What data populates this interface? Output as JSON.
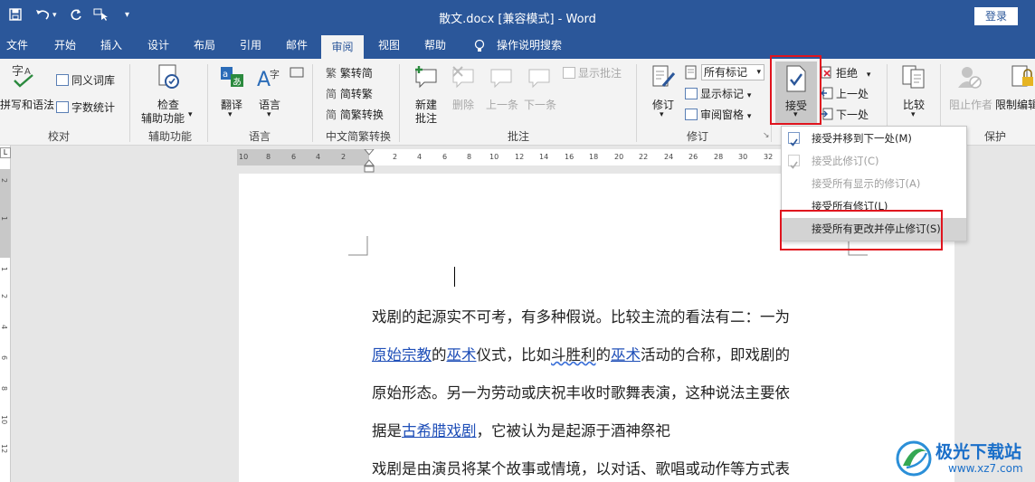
{
  "title_bar": {
    "title": "散文.docx [兼容模式] - Word",
    "login_label": "登录"
  },
  "tabs": [
    "文件",
    "开始",
    "插入",
    "设计",
    "布局",
    "引用",
    "邮件",
    "审阅",
    "视图",
    "帮助",
    "操作说明搜索"
  ],
  "ribbon": {
    "proofing": {
      "spell": "拼写和语法",
      "thesaurus": "同义词库",
      "word_count": "字数统计",
      "group": "校对"
    },
    "accessibility": {
      "check_line1": "检查",
      "check_line2": "辅助功能",
      "group": "辅助功能"
    },
    "language": {
      "translate": "翻译",
      "language": "语言",
      "group": "语言"
    },
    "chinese": {
      "to_simplified": "繁转简",
      "to_traditional": "简转繁",
      "convert": "简繁转换",
      "group": "中文简繁转换"
    },
    "comments": {
      "new_line1": "新建",
      "new_line2": "批注",
      "delete": "删除",
      "prev": "上一条",
      "next": "下一条",
      "show": "显示批注",
      "group": "批注"
    },
    "tracking": {
      "track": "修订",
      "markup_select": "所有标记",
      "show_markup": "显示标记",
      "review_pane": "审阅窗格",
      "group": "修订"
    },
    "changes": {
      "accept": "接受",
      "reject": "拒绝",
      "previous": "上一处",
      "next": "下一处"
    },
    "compare": {
      "compare": "比较"
    },
    "protect": {
      "block_authors": "阻止作者",
      "restrict": "限制编辑",
      "group": "保护"
    }
  },
  "accept_menu": [
    {
      "label": "接受并移到下一处(M)",
      "enabled": true,
      "icon": "accept-check-icon"
    },
    {
      "label": "接受此修订(C)",
      "enabled": false,
      "icon": "accept-check-icon"
    },
    {
      "label": "接受所有显示的修订(A)",
      "enabled": false,
      "icon": ""
    },
    {
      "label": "接受所有修订(L)",
      "enabled": true,
      "icon": ""
    },
    {
      "label": "接受所有更改并停止修订(S)",
      "enabled": true,
      "highlighted": true,
      "icon": ""
    }
  ],
  "ruler": {
    "h_ticks": [
      "10",
      "8",
      "6",
      "4",
      "2",
      "2",
      "4",
      "6",
      "8",
      "10",
      "12",
      "14",
      "16",
      "18",
      "20",
      "22",
      "24",
      "26",
      "28",
      "30",
      "32"
    ],
    "v_ticks": [
      "2",
      "1",
      "1",
      "2",
      "4",
      "6",
      "8",
      "10",
      "12"
    ]
  },
  "document": {
    "line1": "戏剧的起源实不可考，有多种假说。比较主流的看法有二：一为",
    "line2": [
      {
        "text": "原始宗教",
        "link": true
      },
      {
        "text": "的"
      },
      {
        "text": "巫术",
        "link": true
      },
      {
        "text": "仪式，比如"
      },
      {
        "text": "斗胜利",
        "wavy": true
      },
      {
        "text": "的"
      },
      {
        "text": "巫术",
        "link": true
      },
      {
        "text": "活动的合称，即戏剧的"
      }
    ],
    "line3": "原始形态。另一为劳动或庆祝丰收时歌舞表演，这种说法主要依",
    "line4_pre": "据是",
    "line4_link": "古希腊戏剧",
    "line4_post": "，它被认为是起源于酒神祭祀",
    "line5": "戏剧是由演员将某个故事或情境，以对话、歌唱或动作等方式表"
  },
  "watermark": {
    "brand": "极光下载站",
    "url": "www.xz7.com"
  },
  "colors": {
    "title_bar": "#2b579a",
    "highlight_box": "#e0141e",
    "link": "#1f4fb8"
  }
}
